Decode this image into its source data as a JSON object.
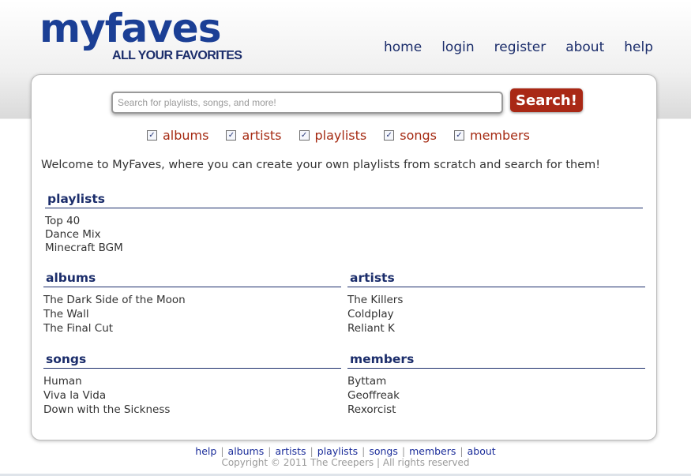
{
  "logo": {
    "name": "myfaves",
    "tagline": "ALL YOUR FAVORITES"
  },
  "nav": [
    "home",
    "login",
    "register",
    "about",
    "help"
  ],
  "search": {
    "placeholder": "Search for playlists, songs, and more!",
    "value": "",
    "button": "Search!"
  },
  "filters": [
    {
      "label": "albums",
      "checked": true
    },
    {
      "label": "artists",
      "checked": true
    },
    {
      "label": "playlists",
      "checked": true
    },
    {
      "label": "songs",
      "checked": true
    },
    {
      "label": "members",
      "checked": true
    }
  ],
  "welcome": "Welcome to MyFaves, where you can create your own playlists from scratch and search for them!",
  "sections": {
    "playlists": {
      "title": "playlists",
      "items": [
        "Top 40",
        "Dance Mix",
        "Minecraft BGM"
      ]
    },
    "albums": {
      "title": "albums",
      "items": [
        "The Dark Side of the Moon",
        "The Wall",
        "The Final Cut"
      ]
    },
    "artists": {
      "title": "artists",
      "items": [
        "The Killers",
        "Coldplay",
        "Reliant K"
      ]
    },
    "songs": {
      "title": "songs",
      "items": [
        "Human",
        "Viva la Vida",
        "Down with the Sickness"
      ]
    },
    "members": {
      "title": "members",
      "items": [
        "Byttam",
        "Geoffreak",
        "Rexorcist"
      ]
    }
  },
  "footer": {
    "links": [
      "help",
      "albums",
      "artists",
      "playlists",
      "songs",
      "members",
      "about"
    ],
    "copyright": "Copyright © 2011 The Creepers  |  All rights reserved"
  },
  "icons": {
    "checkbox_checked": "checkbox-checked-icon"
  },
  "colors": {
    "brand": "#1b3f95",
    "accent": "#a92815",
    "filter_text": "#a52a12"
  }
}
